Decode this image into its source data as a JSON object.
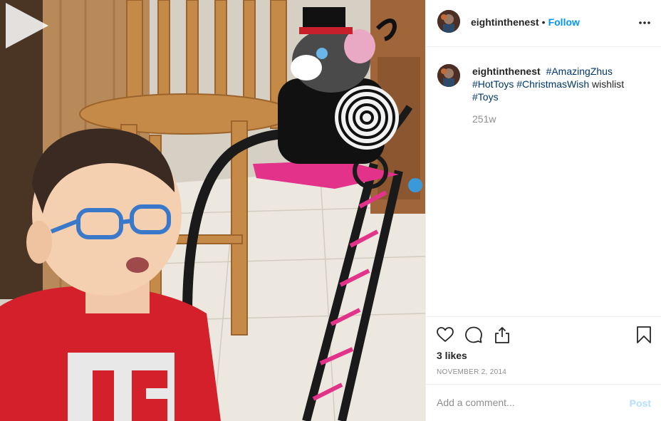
{
  "header": {
    "username": "eightinthenest",
    "separator": "•",
    "follow_label": "Follow",
    "more_icon": "more-options-icon"
  },
  "caption": {
    "username": "eightinthenest",
    "hashtags": [
      "#AmazingZhus",
      "#HotToys",
      "#ChristmasWish",
      "#Toys"
    ],
    "text_between": "wishlist",
    "time_ago": "251w"
  },
  "actions": {
    "like_icon": "heart-icon",
    "comment_icon": "comment-bubble-icon",
    "share_icon": "share-icon",
    "save_icon": "bookmark-icon"
  },
  "likes": "3 likes",
  "date": "NOVEMBER 2, 2014",
  "comment": {
    "placeholder": "Add a comment...",
    "value": "",
    "post_label": "Post"
  },
  "media": {
    "type": "video",
    "play_icon": "play-icon"
  },
  "colors": {
    "link_blue": "#0095f6",
    "hashtag": "#00376b",
    "secondary_text": "#8e8e8e",
    "disabled_post": "#b2dffc",
    "border": "#efefef"
  }
}
